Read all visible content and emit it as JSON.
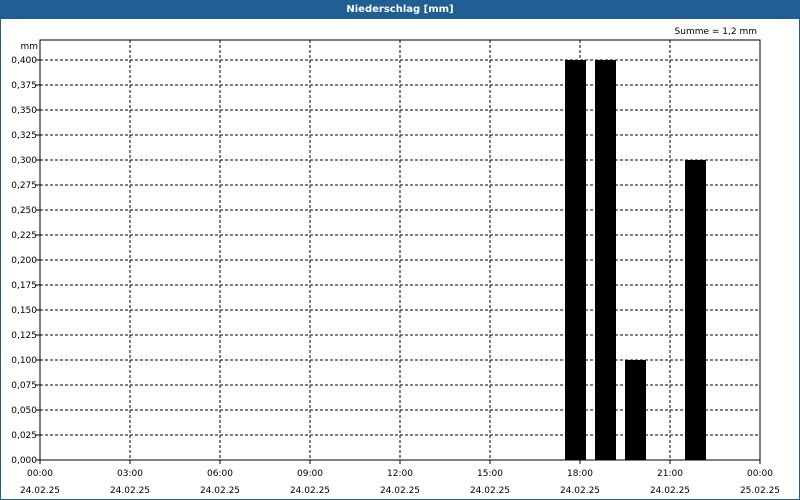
{
  "window": {
    "title": "Niederschlag [mm]"
  },
  "chart_data": {
    "type": "bar",
    "title": "Niederschlag [mm]",
    "ylabel": "mm",
    "summary": "Summe = 1,2 mm",
    "ylim": [
      0,
      0.4
    ],
    "yticks": [
      "0,000",
      "0,025",
      "0,050",
      "0,075",
      "0,100",
      "0,125",
      "0,150",
      "0,175",
      "0,200",
      "0,225",
      "0,250",
      "0,275",
      "0,300",
      "0,325",
      "0,350",
      "0,375",
      "0,400"
    ],
    "xlim_hours": [
      0,
      24
    ],
    "xticks": [
      {
        "time": "00:00",
        "date": "24.02.25"
      },
      {
        "time": "03:00",
        "date": "24.02.25"
      },
      {
        "time": "06:00",
        "date": "24.02.25"
      },
      {
        "time": "09:00",
        "date": "24.02.25"
      },
      {
        "time": "12:00",
        "date": "24.02.25"
      },
      {
        "time": "15:00",
        "date": "24.02.25"
      },
      {
        "time": "18:00",
        "date": "24.02.25"
      },
      {
        "time": "21:00",
        "date": "24.02.25"
      },
      {
        "time": "00:00",
        "date": "25.02.25"
      }
    ],
    "bars": [
      {
        "start_hour": 17.5,
        "end_hour": 18.2,
        "value": 0.4
      },
      {
        "start_hour": 18.5,
        "end_hour": 19.2,
        "value": 0.4
      },
      {
        "start_hour": 19.5,
        "end_hour": 20.2,
        "value": 0.1
      },
      {
        "start_hour": 21.5,
        "end_hour": 22.2,
        "value": 0.3
      }
    ],
    "bar_color": "#000000",
    "grid": true,
    "grid_style": "dashed"
  }
}
